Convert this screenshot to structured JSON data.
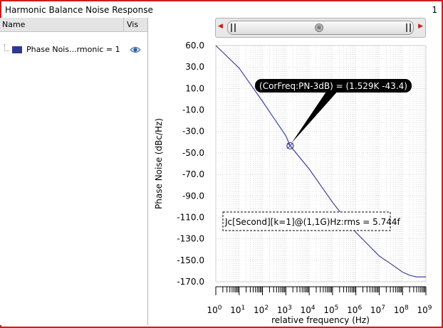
{
  "window": {
    "title": "Harmonic Balance Noise Response",
    "page_number": "1"
  },
  "legend": {
    "col_name": "Name",
    "col_vis": "Vis",
    "items": [
      {
        "label": "Phase Nois...rmonic = 1",
        "color": "#2f3696",
        "icon": "eye-icon"
      }
    ]
  },
  "scrollbar": {
    "left_arrow": "left-arrow-icon",
    "right_arrow": "right-arrow-icon",
    "grip": "grip-icon"
  },
  "chart_data": {
    "type": "line",
    "title": "",
    "xlabel": "relative frequency (Hz)",
    "ylabel": "Phase Noise (dBc/Hz)",
    "xscale": "log",
    "xlim": [
      1,
      1000000000
    ],
    "ylim": [
      -170,
      60
    ],
    "yticks": [
      60.0,
      30.0,
      10.0,
      -10.0,
      -30.0,
      -50.0,
      -70.0,
      -90.0,
      -110.0,
      -130.0,
      -150.0,
      -170.0
    ],
    "ytick_labels": [
      "60.0",
      "30.0",
      "10.0",
      "-10.0",
      "-30.0",
      "-50.0",
      "-70.0",
      "-90.0",
      "-110.0",
      "-130.0",
      "-150.0",
      "-170.0"
    ],
    "xticks": [
      1,
      10,
      100,
      1000,
      10000,
      100000,
      1000000,
      10000000,
      100000000,
      1000000000
    ],
    "xtick_bases": [
      "10",
      "10",
      "10",
      "10",
      "10",
      "10",
      "10",
      "10",
      "10",
      "10"
    ],
    "xtick_exponents": [
      "0",
      "1",
      "2",
      "3",
      "4",
      "5",
      "6",
      "7",
      "8",
      "9"
    ],
    "grid": true,
    "series": [
      {
        "color": "#2f3696",
        "x": [
          1,
          10,
          100,
          1000,
          1529,
          10000,
          100000,
          1000000,
          10000000,
          30000000,
          100000000,
          200000000,
          400000000,
          1000000000
        ],
        "y": [
          60,
          29,
          -2,
          -34,
          -43.4,
          -65,
          -96,
          -124,
          -146,
          -153,
          -161,
          -164,
          -165.5,
          -165.5
        ]
      }
    ],
    "marker": {
      "x": 1529,
      "y": -43.4,
      "label": "(CorFreq:PN-3dB) = (1.529K -43.4)"
    },
    "annotation": "Jc[Second][k=1]@(1,1G)Hz:rms = 5.744f"
  }
}
